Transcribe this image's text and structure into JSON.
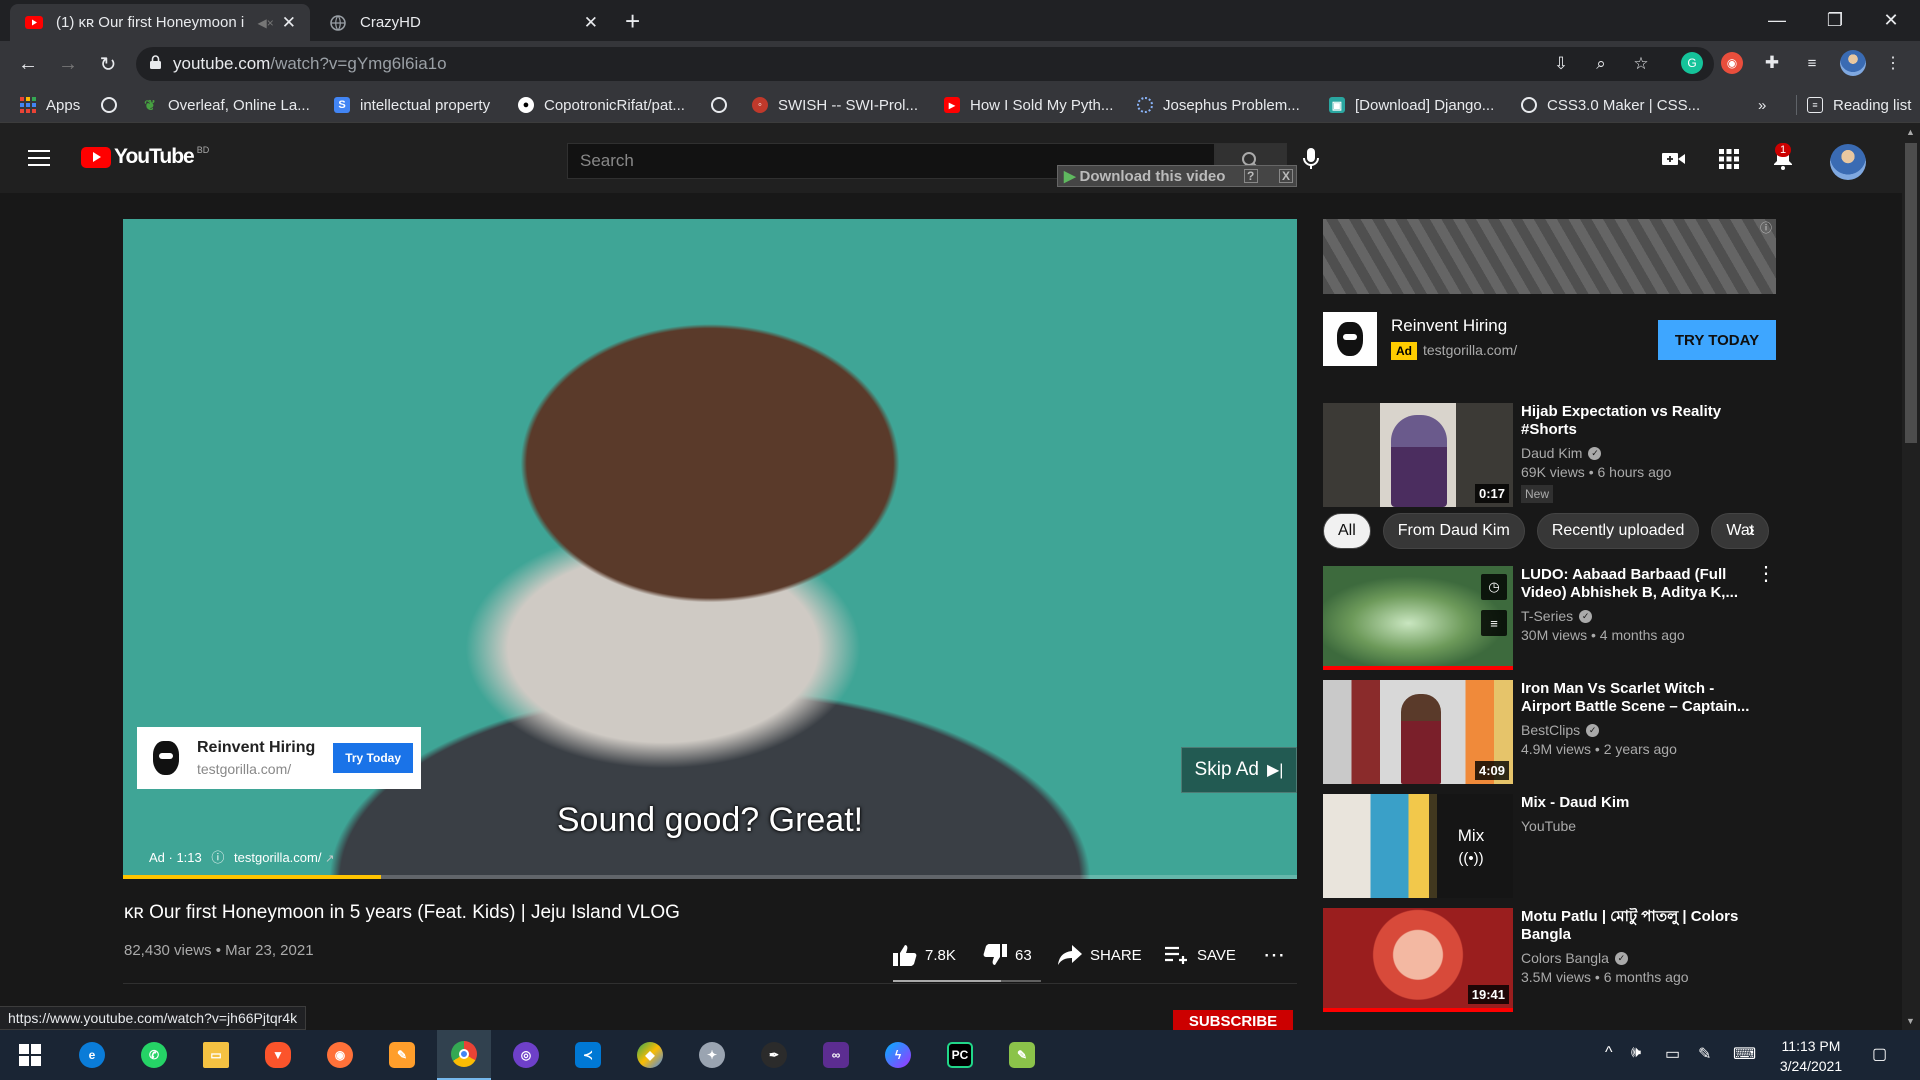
{
  "browser": {
    "tabs": [
      {
        "title": "(1) ᴋʀ Our first Honeymoon i",
        "active": true
      },
      {
        "title": "CrazyHD",
        "active": false
      }
    ],
    "url_host": "youtube.com",
    "url_path": "/watch?v=gYmg6l6ia1o",
    "bookmarks": [
      {
        "label": "Apps",
        "icon": "apps-grid-icon"
      },
      {
        "label": "",
        "icon": "globe-icon"
      },
      {
        "label": "Overleaf, Online La...",
        "icon": "overleaf-icon"
      },
      {
        "label": "intellectual property",
        "icon": "scholar-icon"
      },
      {
        "label": "CopotronicRifat/pat...",
        "icon": "github-icon"
      },
      {
        "label": "",
        "icon": "globe-icon"
      },
      {
        "label": "SWISH -- SWI-Prol...",
        "icon": "swish-icon"
      },
      {
        "label": "How I Sold My Pyth...",
        "icon": "youtube-icon"
      },
      {
        "label": "Josephus Problem...",
        "icon": "loading-icon"
      },
      {
        "label": "[Download] Django...",
        "icon": "download-site-icon"
      },
      {
        "label": "CSS3.0 Maker | CSS...",
        "icon": "globe-icon"
      }
    ],
    "bookmarks_overflow": "»",
    "reading_list": "Reading list",
    "hover_url": "https://www.youtube.com/watch?v=jh66Pjtqr4k"
  },
  "youtube": {
    "logo_text": "YouTube",
    "country_code": "BD",
    "search_placeholder": "Search",
    "download_bar": "Download this video",
    "download_help": "?",
    "download_close": "X",
    "notification_count": "1"
  },
  "player": {
    "subtitle": "Sound good? Great!",
    "ad_card": {
      "title": "Reinvent Hiring",
      "domain": "testgorilla.com/",
      "button": "Try Today"
    },
    "skip_label": "Skip Ad",
    "ad_info": "Ad · 1:13",
    "ad_link": "testgorilla.com/",
    "progress_fraction": 0.22
  },
  "video": {
    "title": "ᴋʀ Our first Honeymoon in 5 years (Feat. Kids) | Jeju Island VLOG",
    "views": "82,430 views",
    "date": "Mar 23, 2021",
    "likes": "7.8K",
    "dislikes": "63",
    "like_fraction": 0.73,
    "share": "SHARE",
    "save": "SAVE",
    "subscribe": "SUBSCRIBE"
  },
  "sidebar_ad": {
    "title": "Reinvent Hiring",
    "ad_tag": "Ad",
    "domain": "testgorilla.com/",
    "button": "TRY TODAY"
  },
  "chips": [
    "All",
    "From Daud Kim",
    "Recently uploaded",
    "Wat"
  ],
  "recommendations": [
    {
      "title": "Hijab Expectation vs Reality #Shorts",
      "channel": "Daud Kim",
      "verified": true,
      "stats": "69K views • 6 hours ago",
      "badge": "New",
      "duration": "0:17"
    },
    {
      "title": "LUDO: Aabaad Barbaad (Full Video) Abhishek B, Aditya K,...",
      "channel": "T-Series",
      "verified": true,
      "stats": "30M views • 4 months ago",
      "watched_fraction": 1.0
    },
    {
      "title": "Iron Man Vs Scarlet Witch - Airport Battle Scene – Captain...",
      "channel": "BestClips",
      "verified": true,
      "stats": "4.9M views • 2 years ago",
      "duration": "4:09"
    },
    {
      "title": "Mix - Daud Kim",
      "channel": "YouTube",
      "verified": false,
      "stats": "",
      "mix_label": "Mix"
    },
    {
      "title": "Motu Patlu | মোটু পাতলু | Colors Bangla",
      "channel": "Colors Bangla",
      "verified": true,
      "stats": "3.5M views • 6 months ago",
      "duration": "19:41",
      "watched_fraction": 1.0
    }
  ],
  "taskbar": {
    "time": "11:13 PM",
    "date": "3/24/2021",
    "apps": [
      "windows-start-icon",
      "edge-icon",
      "whatsapp-icon",
      "file-explorer-icon",
      "brave-icon",
      "firefox-icon",
      "app-orange-icon",
      "chrome-icon",
      "github-desktop-icon",
      "vscode-icon",
      "maps-icon",
      "app-gray-icon",
      "inkscape-icon",
      "visual-studio-icon",
      "messenger-icon",
      "pycharm-icon",
      "notepad-icon"
    ]
  },
  "colors": {
    "yt_red": "#ff0000",
    "accent_blue": "#3ea6ff",
    "ad_yellow": "#fecc00",
    "ad_progress": "#ffc400"
  }
}
